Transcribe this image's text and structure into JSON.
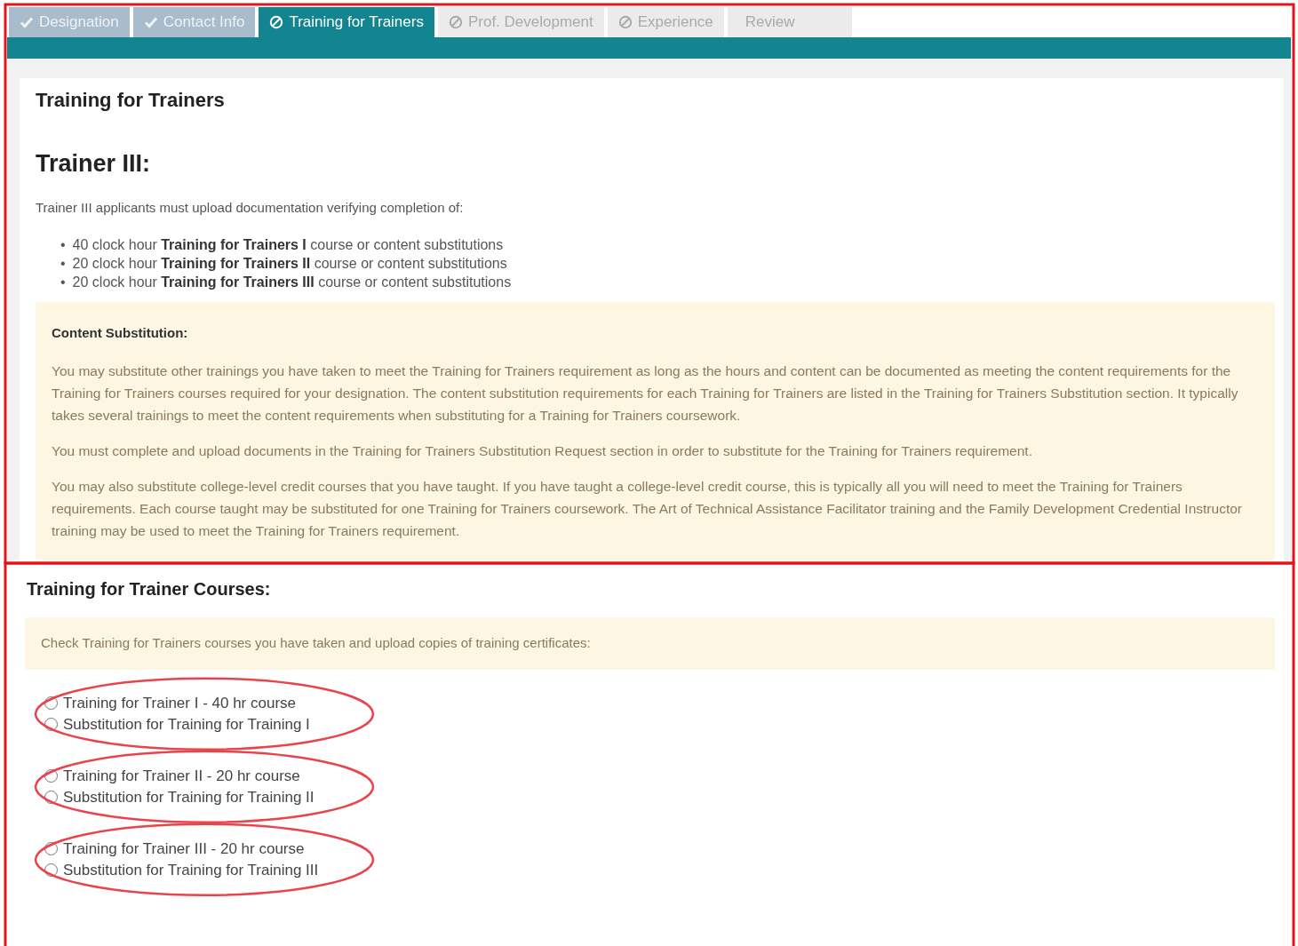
{
  "tabs": [
    {
      "label": "Designation",
      "kind": "done",
      "selected": false
    },
    {
      "label": "Contact Info",
      "kind": "done",
      "selected": false
    },
    {
      "label": "Training for Trainers",
      "kind": "blocked",
      "selected": true
    },
    {
      "label": "Prof. Development",
      "kind": "blocked",
      "selected": false
    },
    {
      "label": "Experience",
      "kind": "blocked",
      "selected": false
    },
    {
      "label": "Review",
      "kind": "plain",
      "selected": false
    }
  ],
  "section": {
    "title": "Training for Trainers",
    "heading": "Trainer III:",
    "intro": "Trainer III applicants must upload documentation verifying completion of:",
    "requirements": [
      {
        "bullet": "•",
        "text": "40 clock hour **Training for Trainers I** course or content substitutions"
      },
      {
        "bullet": "•",
        "text": "20 clock hour **Training for Trainers II** course or content substitutions"
      },
      {
        "bullet": "•",
        "text": "20 clock hour **Training for Trainers III** course or content substitutions"
      }
    ],
    "notice": {
      "title": "Content Substitution:",
      "paragraphs": [
        "You may substitute other trainings you have taken to meet the Training for Trainers requirement as long as the hours and content can be documented as meeting the content requirements for the Training for Trainers courses required for your designation. The content substitution requirements for each Training for Trainers are listed in the Training for Trainers Substitution section. It typically takes several trainings to meet the content requirements when substituting for a Training for Trainers coursework.",
        "You must complete and upload documents in the Training for Trainers Substitution Request section in order to substitute for the Training for Trainers requirement.",
        "You may also substitute college-level credit courses that you have taught. If you have taught a college-level credit course, this is typically all you will need to meet the Training for Trainers requirements. Each course taught may be substituted for one Training for Trainers coursework. The Art of Technical Assistance Facilitator training and the Family Development Credential Instructor training may be used to meet the Training for Trainers requirement."
      ]
    }
  },
  "courses": {
    "title": "Training for Trainer Courses:",
    "instruction": "Check Training for Trainers courses you have taken and upload copies of training certificates:",
    "groups": [
      {
        "options": [
          {
            "label": "Training for Trainer I - 40 hr course",
            "checked": false
          },
          {
            "label": "Substitution for Training for Training I",
            "checked": false
          }
        ]
      },
      {
        "options": [
          {
            "label": "Training for Trainer II - 20 hr course",
            "checked": false
          },
          {
            "label": "Substitution for Training for Training II",
            "checked": false
          }
        ]
      },
      {
        "options": [
          {
            "label": "Training for Trainer III - 20 hr course",
            "checked": false
          },
          {
            "label": "Substitution for Training for Training III",
            "checked": false
          }
        ]
      }
    ]
  }
}
